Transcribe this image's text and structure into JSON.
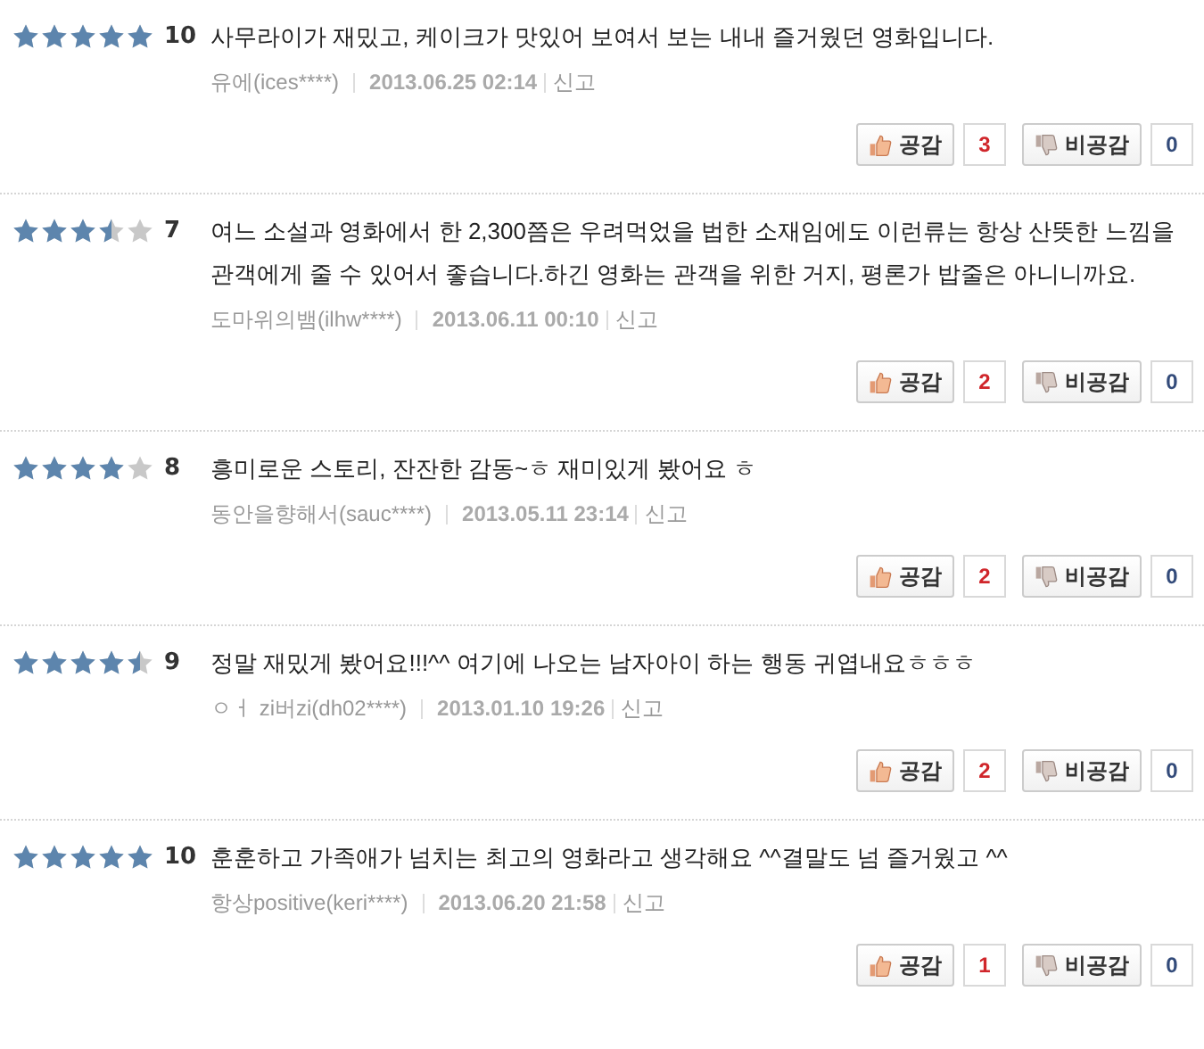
{
  "reviews": [
    {
      "stars": 5,
      "score": "10",
      "text": "사무라이가 재밌고, 케이크가 맛있어 보여서 보는 내내 즐거웠던 영화입니다.",
      "author": "유에(ices****)",
      "date": "2013.06.25 02:14",
      "report": "신고",
      "like_label": "공감",
      "likes": "3",
      "dislike_label": "비공감",
      "dislikes": "0"
    },
    {
      "stars": 3.5,
      "score": "7",
      "text": "여느 소설과 영화에서 한 2,300쯤은 우려먹었을 법한 소재임에도 이런류는 항상 산뜻한 느낌을 관객에게 줄 수 있어서 좋습니다.하긴 영화는 관객을 위한 거지, 평론가 밥줄은 아니니까요.",
      "author": "도마위의뱀(ilhw****)",
      "date": "2013.06.11 00:10",
      "report": "신고",
      "like_label": "공감",
      "likes": "2",
      "dislike_label": "비공감",
      "dislikes": "0"
    },
    {
      "stars": 4,
      "score": "8",
      "text": "흥미로운 스토리, 잔잔한 감동~ㅎ 재미있게 봤어요 ㅎ",
      "author": "동안을향해서(sauc****)",
      "date": "2013.05.11 23:14",
      "report": "신고",
      "like_label": "공감",
      "likes": "2",
      "dislike_label": "비공감",
      "dislikes": "0"
    },
    {
      "stars": 4.5,
      "score": "9",
      "text": "정말 재밌게 봤어요!!!^^ 여기에 나오는 남자아이 하는 행동 귀엽내요ㅎㅎㅎ",
      "author": "ㅇㅓ zi버zi(dh02****)",
      "date": "2013.01.10 19:26",
      "report": "신고",
      "like_label": "공감",
      "likes": "2",
      "dislike_label": "비공감",
      "dislikes": "0"
    },
    {
      "stars": 5,
      "score": "10",
      "text": "훈훈하고 가족애가 넘치는 최고의 영화라고 생각해요 ^^결말도 넘 즐거웠고 ^^",
      "author": "항상positive(keri****)",
      "date": "2013.06.20 21:58",
      "report": "신고",
      "like_label": "공감",
      "likes": "1",
      "dislike_label": "비공감",
      "dislikes": "0"
    }
  ]
}
